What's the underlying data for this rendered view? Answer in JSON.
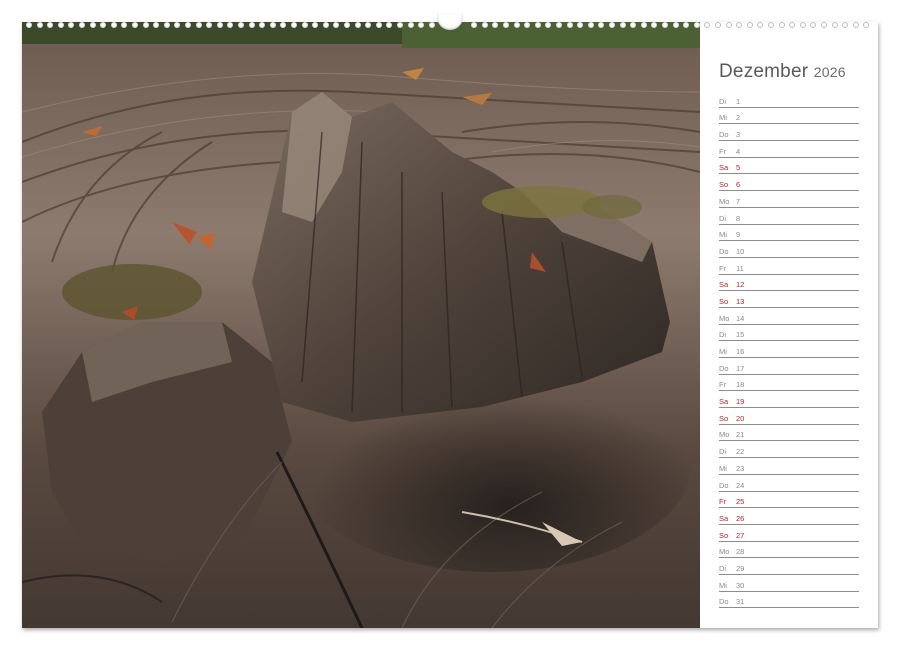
{
  "calendar": {
    "month": "Dezember",
    "year": "2026",
    "days": [
      {
        "wd": "Di",
        "d": "1",
        "red": false
      },
      {
        "wd": "Mi",
        "d": "2",
        "red": false
      },
      {
        "wd": "Do",
        "d": "3",
        "red": false
      },
      {
        "wd": "Fr",
        "d": "4",
        "red": false
      },
      {
        "wd": "Sa",
        "d": "5",
        "red": true
      },
      {
        "wd": "So",
        "d": "6",
        "red": true
      },
      {
        "wd": "Mo",
        "d": "7",
        "red": false
      },
      {
        "wd": "Di",
        "d": "8",
        "red": false
      },
      {
        "wd": "Mi",
        "d": "9",
        "red": false
      },
      {
        "wd": "Do",
        "d": "10",
        "red": false
      },
      {
        "wd": "Fr",
        "d": "11",
        "red": false
      },
      {
        "wd": "Sa",
        "d": "12",
        "red": true
      },
      {
        "wd": "So",
        "d": "13",
        "red": true
      },
      {
        "wd": "Mo",
        "d": "14",
        "red": false
      },
      {
        "wd": "Di",
        "d": "15",
        "red": false
      },
      {
        "wd": "Mi",
        "d": "16",
        "red": false
      },
      {
        "wd": "Do",
        "d": "17",
        "red": false
      },
      {
        "wd": "Fr",
        "d": "18",
        "red": false
      },
      {
        "wd": "Sa",
        "d": "19",
        "red": true
      },
      {
        "wd": "So",
        "d": "20",
        "red": true
      },
      {
        "wd": "Mo",
        "d": "21",
        "red": false
      },
      {
        "wd": "Di",
        "d": "22",
        "red": false
      },
      {
        "wd": "Mi",
        "d": "23",
        "red": false
      },
      {
        "wd": "Do",
        "d": "24",
        "red": false
      },
      {
        "wd": "Fr",
        "d": "25",
        "red": true
      },
      {
        "wd": "Sa",
        "d": "26",
        "red": true
      },
      {
        "wd": "So",
        "d": "27",
        "red": true
      },
      {
        "wd": "Mo",
        "d": "28",
        "red": false
      },
      {
        "wd": "Di",
        "d": "29",
        "red": false
      },
      {
        "wd": "Mi",
        "d": "30",
        "red": false
      },
      {
        "wd": "Do",
        "d": "31",
        "red": false
      }
    ]
  },
  "colors": {
    "holiday": "#b3261e",
    "weekday": "#8a8a8a",
    "wood_light": "#8a7a6e",
    "wood_dark": "#3e3631"
  },
  "photo": {
    "subject": "tree-stump-icon"
  }
}
